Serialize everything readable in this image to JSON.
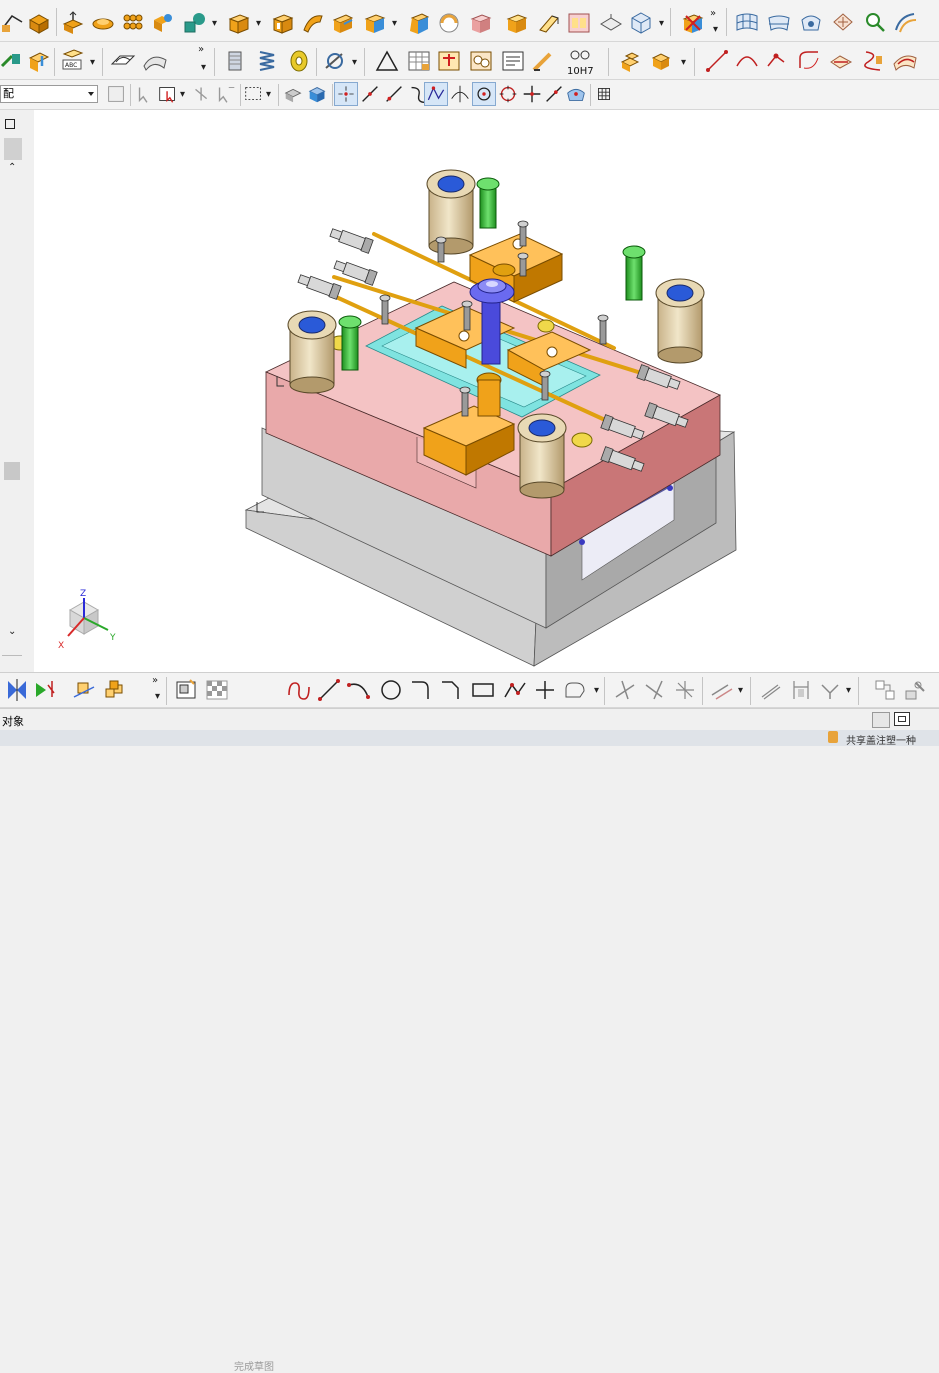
{
  "toolbar": {
    "filter_select_value": "配",
    "finish_sketch_label": "完成草图",
    "tolerance_label": "10H7"
  },
  "statusbar": {
    "text": "对象"
  },
  "bottombar": {
    "text": "共享盖注塑一种"
  },
  "triad": {
    "x": "X",
    "y": "Y",
    "z": "Z"
  },
  "colors": {
    "plate_pink": "#e9a9aa",
    "plate_grey": "#c8c8c8",
    "slider_orange": "#f0a21a",
    "screw_green": "#2fbf2f",
    "sprue_blue": "#4a4adb",
    "cavity_cyan": "#7fe3e0"
  }
}
